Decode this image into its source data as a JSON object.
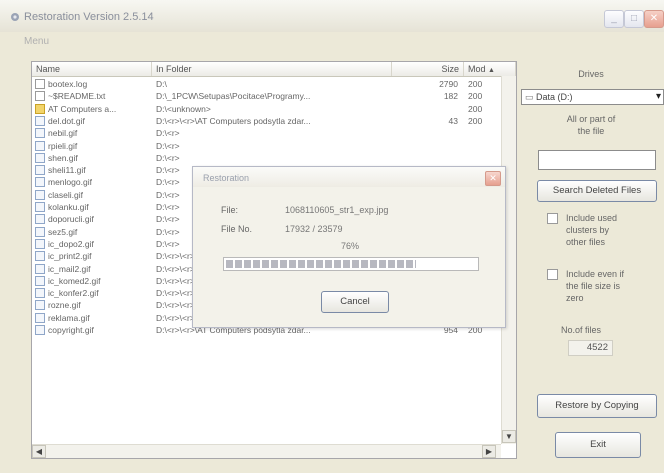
{
  "window": {
    "title": "Restoration Version 2.5.14"
  },
  "menu": {
    "items": [
      "Menu"
    ]
  },
  "list": {
    "columns": [
      "Name",
      "In Folder",
      "Size",
      "Mod"
    ],
    "rows": [
      {
        "name": "bootex.log",
        "folder": "D:\\",
        "size": "2790",
        "mod": "200",
        "icon": "doc"
      },
      {
        "name": "~$README.txt",
        "folder": "D:\\_1PCW\\Setupas\\Pocitace\\Programy...",
        "size": "182",
        "mod": "200",
        "icon": "doc"
      },
      {
        "name": "AT Computers a...",
        "folder": "D:\\<unknown>",
        "size": "",
        "mod": "200",
        "icon": "folder"
      },
      {
        "name": "del.dot.gif",
        "folder": "D:\\<r>\\<r>\\AT Computers podsytla zdar...",
        "size": "43",
        "mod": "200",
        "icon": "img"
      },
      {
        "name": "nebil.gif",
        "folder": "D:\\<r>",
        "size": "",
        "mod": "",
        "icon": "img"
      },
      {
        "name": "rpieli.gif",
        "folder": "D:\\<r>",
        "size": "",
        "mod": "",
        "icon": "img"
      },
      {
        "name": "shen.gif",
        "folder": "D:\\<r>",
        "size": "",
        "mod": "",
        "icon": "img"
      },
      {
        "name": "sheli11.gif",
        "folder": "D:\\<r>",
        "size": "",
        "mod": "",
        "icon": "img"
      },
      {
        "name": "menlogo.gif",
        "folder": "D:\\<r>",
        "size": "",
        "mod": "",
        "icon": "img"
      },
      {
        "name": "claseli.gif",
        "folder": "D:\\<r>",
        "size": "",
        "mod": "",
        "icon": "img"
      },
      {
        "name": "kolanku.gif",
        "folder": "D:\\<r>",
        "size": "",
        "mod": "",
        "icon": "img"
      },
      {
        "name": "doporucli.gif",
        "folder": "D:\\<r>",
        "size": "",
        "mod": "",
        "icon": "img"
      },
      {
        "name": "sez5.gif",
        "folder": "D:\\<r>",
        "size": "",
        "mod": "",
        "icon": "img"
      },
      {
        "name": "ic_dopo2.gif",
        "folder": "D:\\<r>",
        "size": "",
        "mod": "",
        "icon": "img"
      },
      {
        "name": "ic_print2.gif",
        "folder": "D:\\<r>\\<r>\\AT Computers podsytla zdar...",
        "size": "1111",
        "mod": "200",
        "icon": "img"
      },
      {
        "name": "ic_mail2.gif",
        "folder": "D:\\<r>\\<r>\\AT Computers podsytla zdar...",
        "size": "917",
        "mod": "200",
        "icon": "img"
      },
      {
        "name": "ic_komed2.gif",
        "folder": "D:\\<r>\\<r>\\AT Computers podsytla zdar...",
        "size": "962",
        "mod": "200",
        "icon": "img"
      },
      {
        "name": "ic_konfer2.gif",
        "folder": "D:\\<r>\\<r>\\AT Computers podsytla zdar...",
        "size": "981",
        "mod": "200",
        "icon": "img"
      },
      {
        "name": "rozne.gif",
        "folder": "D:\\<r>\\<r>\\AT Computers podsytla zdar...",
        "size": "1144",
        "mod": "200",
        "icon": "img"
      },
      {
        "name": "reklama.gif",
        "folder": "D:\\<r>\\<r>\\AT Computers podsytla zdar...",
        "size": "988",
        "mod": "200",
        "icon": "img"
      },
      {
        "name": "copyright.gif",
        "folder": "D:\\<r>\\<r>\\AT Computers podsytla zdar...",
        "size": "954",
        "mod": "200",
        "icon": "img"
      }
    ]
  },
  "side": {
    "drives_label": "Drives",
    "drive_selected": "Data (D:)",
    "all_or_part": [
      "All or part of",
      "the file"
    ],
    "search_value": "",
    "search_button": "Search Deleted Files",
    "include_used": [
      "Include used",
      "clusters by",
      "other files"
    ],
    "include_zero": [
      "Include even if",
      "the file size is",
      "zero"
    ],
    "num_files_label": "No.of files",
    "num_files_value": "4522",
    "restore_button": "Restore by Copying",
    "exit_button": "Exit"
  },
  "dialog": {
    "title": "Restoration",
    "file_label": "File:",
    "file_value": "1068110605_str1_exp.jpg",
    "fileno_label": "File No.",
    "fileno_value": "17932 / 23579",
    "percent": "76%",
    "progress_fraction": 0.76,
    "cancel_button": "Cancel"
  },
  "icons": {
    "app": "app-icon",
    "minimize": "minimize-icon",
    "maximize": "maximize-icon",
    "close": "close-icon"
  }
}
